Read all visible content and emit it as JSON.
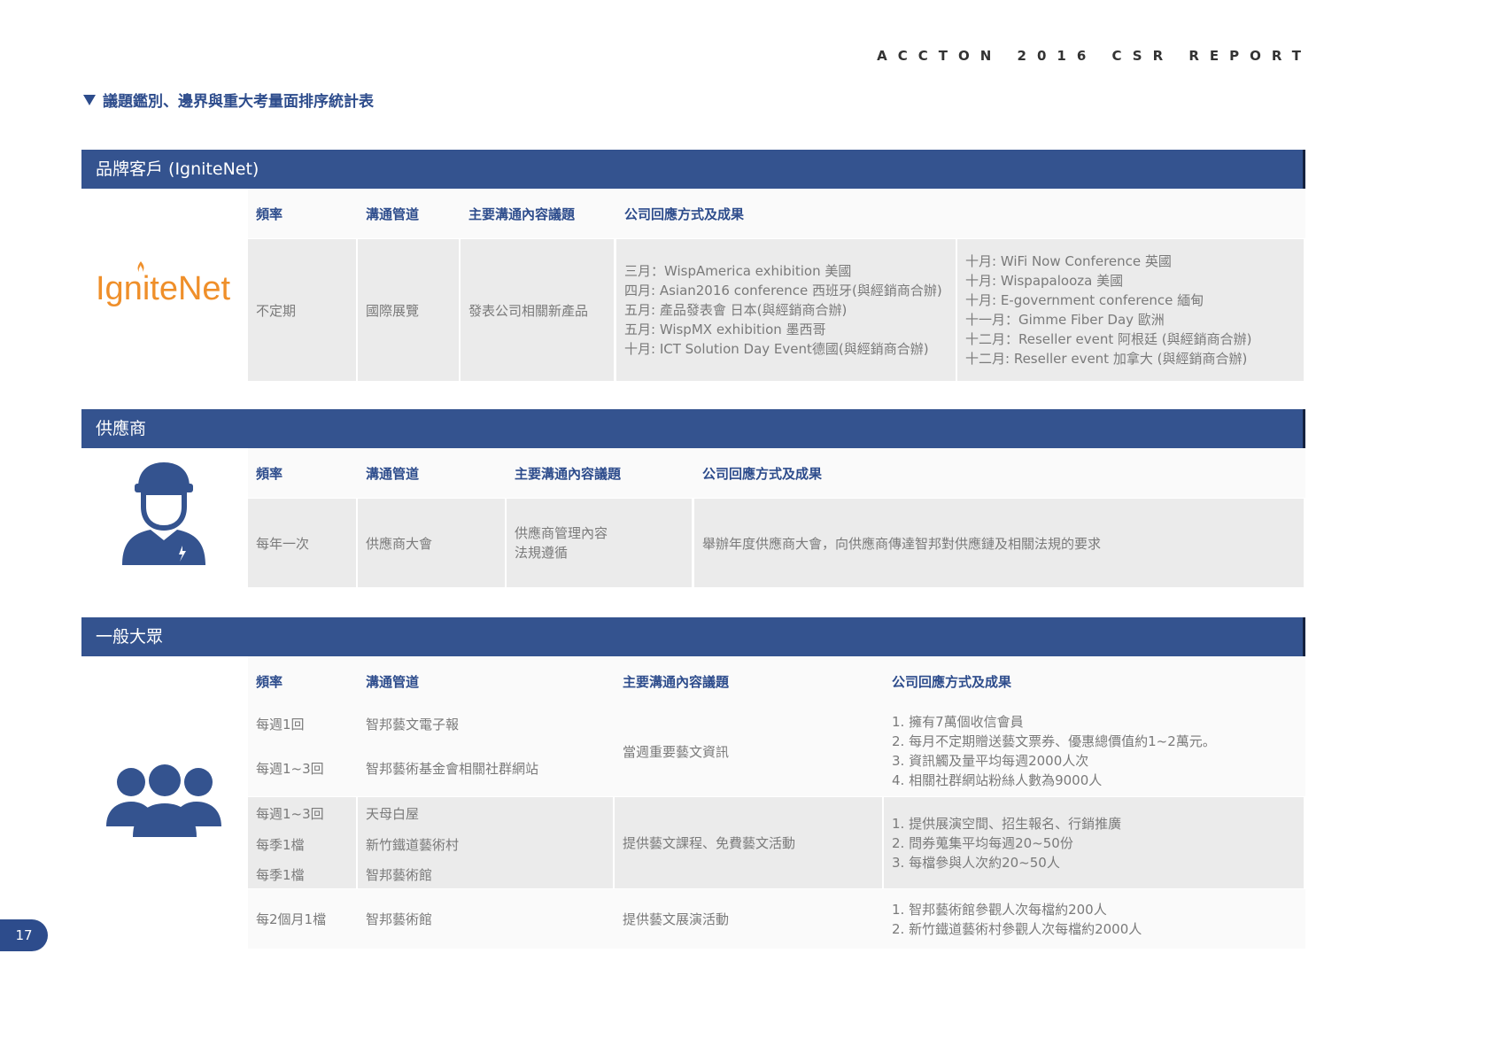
{
  "report_header": "ACCTON 2016 CSR REPORT",
  "page_title": "議題鑑別、邊界與重大考量面排序統計表",
  "page_number": "17",
  "sections": {
    "brand": {
      "title": "品牌客戶 (IgniteNet)",
      "logo_text": "IgniteNet",
      "headers": [
        "頻率",
        "溝通管道",
        "主要溝通內容議題",
        "公司回應方式及成果"
      ],
      "frequency": "不定期",
      "channel": "國際展覽",
      "topic": "發表公司相關新產品",
      "results_left": [
        "三月：WispAmerica exhibition 美國",
        "四月:  Asian2016 conference 西班牙(與經銷商合辦)",
        "五月:  產品發表會 日本(與經銷商合辦)",
        "五月:  WispMX exhibition 墨西哥",
        "十月: ICT Solution Day Event德國(與經銷商合辦)"
      ],
      "results_right": [
        "十月: WiFi Now Conference 英國",
        "十月: Wispapalooza 美國",
        "十月: E-government conference 緬甸",
        "十一月：Gimme Fiber Day 歐洲",
        "十二月：Reseller event 阿根廷 (與經銷商合辦)",
        "十二月: Reseller event 加拿大 (與經銷商合辦)"
      ]
    },
    "supplier": {
      "title": "供應商",
      "icon": "worker-icon",
      "headers": [
        "頻率",
        "溝通管道",
        "主要溝通內容議題",
        "公司回應方式及成果"
      ],
      "frequency": "每年一次",
      "channel": "供應商大會",
      "topics": [
        "供應商管理內容",
        "法規遵循"
      ],
      "result": "舉辦年度供應商大會，向供應商傳達智邦對供應鏈及相關法規的要求"
    },
    "public": {
      "title": "一般大眾",
      "icon": "people-group-icon",
      "headers": [
        "頻率",
        "溝通管道",
        "主要溝通內容議題",
        "公司回應方式及成果"
      ],
      "groups": [
        {
          "rows": [
            {
              "frequency": "每週1回",
              "channel": "智邦藝文電子報"
            },
            {
              "frequency": "每週1~3回",
              "channel": "智邦藝術基金會相關社群網站"
            }
          ],
          "topic": "當週重要藝文資訊",
          "results": [
            "1. 擁有7萬個收信會員",
            "2. 每月不定期贈送藝文票券、優惠總價值約1~2萬元。",
            "3. 資訊觸及量平均每週2000人次",
            "4. 相關社群網站粉絲人數為9000人"
          ]
        },
        {
          "rows": [
            {
              "frequency": "每週1~3回",
              "channel": "天母白屋"
            },
            {
              "frequency": "每季1檔",
              "channel": "新竹鐵道藝術村"
            },
            {
              "frequency": "每季1檔",
              "channel": "智邦藝術館"
            }
          ],
          "topic": "提供藝文課程、免費藝文活動",
          "results": [
            "1. 提供展演空間、招生報名、行銷推廣",
            "2. 問券蒐集平均每週20~50份",
            "3. 每檔參與人次約20~50人"
          ]
        },
        {
          "rows": [
            {
              "frequency": "每2個月1檔",
              "channel": "智邦藝術館"
            }
          ],
          "topic": "提供藝文展演活動",
          "results": [
            "1. 智邦藝術館參觀人次每檔約200人",
            "2. 新竹鐵道藝術村參觀人次每檔約2000人"
          ]
        }
      ]
    }
  },
  "colors": {
    "accent": "#34538f",
    "logo_orange": "#ef8f2a",
    "cell_shade": "#ebebeb"
  }
}
